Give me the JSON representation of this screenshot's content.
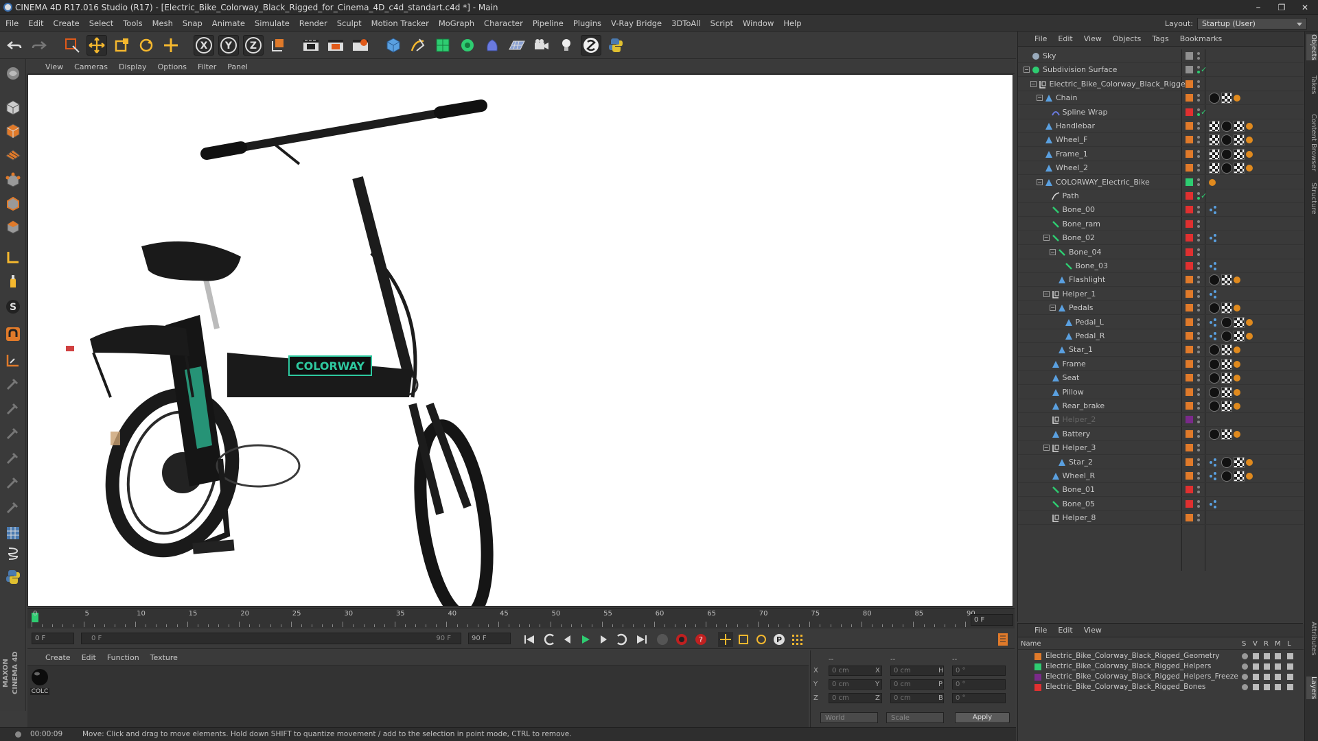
{
  "window": {
    "title": "CINEMA 4D R17.016 Studio (R17) - [Electric_Bike_Colorway_Black_Rigged_for_Cinema_4D_c4d_standart.c4d *] - Main",
    "minimize": "–",
    "maximize": "❐",
    "close": "✕"
  },
  "menubar": {
    "items": [
      "File",
      "Edit",
      "Create",
      "Select",
      "Tools",
      "Mesh",
      "Snap",
      "Animate",
      "Simulate",
      "Render",
      "Sculpt",
      "Motion Tracker",
      "MoGraph",
      "Character",
      "Pipeline",
      "Plugins",
      "V-Ray Bridge",
      "3DToAll",
      "Script",
      "Window",
      "Help"
    ],
    "layout_label": "Layout:",
    "layout_value": "Startup (User)"
  },
  "viewport": {
    "menu": [
      "View",
      "Cameras",
      "Display",
      "Options",
      "Filter",
      "Panel"
    ],
    "logo_text": "COLORWAY"
  },
  "timeline": {
    "labels": [
      "0",
      "5",
      "10",
      "15",
      "20",
      "25",
      "30",
      "35",
      "40",
      "45",
      "50",
      "55",
      "60",
      "65",
      "70",
      "75",
      "80",
      "85",
      "90"
    ],
    "frame_end_field": "0 F",
    "start_field": "0 F",
    "range_left": "0 F",
    "range_right": "90 F",
    "end_field": "90 F"
  },
  "materials": {
    "menu": [
      "Create",
      "Edit",
      "Function",
      "Texture"
    ],
    "items": [
      {
        "label": "COLC"
      }
    ]
  },
  "coords": {
    "col1_header": "--",
    "col2_header": "--",
    "col3_header": "--",
    "rows": [
      {
        "axis": "X",
        "pos": "0 cm",
        "axis2": "X",
        "size": "0 cm",
        "axis3": "H",
        "rot": "0 °"
      },
      {
        "axis": "Y",
        "pos": "0 cm",
        "axis2": "Y",
        "size": "0 cm",
        "axis3": "P",
        "rot": "0 °"
      },
      {
        "axis": "Z",
        "pos": "0 cm",
        "axis2": "Z",
        "size": "0 cm",
        "axis3": "B",
        "rot": "0 °"
      }
    ],
    "mode": "World",
    "size_mode": "Scale",
    "apply": "Apply"
  },
  "status": {
    "time": "00:00:09",
    "message": "Move: Click and drag to move elements. Hold down SHIFT to quantize movement / add to the selection in point mode, CTRL to remove."
  },
  "objects": {
    "menu": [
      "File",
      "Edit",
      "View",
      "Objects",
      "Tags",
      "Bookmarks"
    ],
    "items": [
      {
        "name": "Sky",
        "indent": 0,
        "color": "#909090",
        "icon": "sky",
        "tags": []
      },
      {
        "name": "Subdivision Surface",
        "indent": 0,
        "color": "#909090",
        "icon": "subd",
        "tags": [],
        "check": true
      },
      {
        "name": "Electric_Bike_Colorway_Black_Rigged",
        "indent": 1,
        "color": "#e07a2a",
        "icon": "null",
        "tags": []
      },
      {
        "name": "Chain",
        "indent": 2,
        "color": "#e07a2a",
        "icon": "poly",
        "tags": [
          "b",
          "c",
          "o"
        ]
      },
      {
        "name": "Spline Wrap",
        "indent": 3,
        "color": "#e03030",
        "icon": "deform",
        "tags": [],
        "check": true
      },
      {
        "name": "Handlebar",
        "indent": 2,
        "color": "#e07a2a",
        "icon": "poly",
        "tags": [
          "p",
          "b",
          "c",
          "o"
        ]
      },
      {
        "name": "Wheel_F",
        "indent": 2,
        "color": "#e07a2a",
        "icon": "poly",
        "tags": [
          "p",
          "b",
          "c",
          "o"
        ]
      },
      {
        "name": "Frame_1",
        "indent": 2,
        "color": "#e07a2a",
        "icon": "poly",
        "tags": [
          "p",
          "b",
          "c",
          "o"
        ]
      },
      {
        "name": "Wheel_2",
        "indent": 2,
        "color": "#e07a2a",
        "icon": "poly",
        "tags": [
          "p",
          "b",
          "c",
          "o"
        ]
      },
      {
        "name": "COLORWAY_Electric_Bike",
        "indent": 2,
        "color": "#2ecc71",
        "icon": "poly",
        "tags": [
          "o"
        ]
      },
      {
        "name": "Path",
        "indent": 3,
        "color": "#e03030",
        "icon": "spline",
        "tags": [],
        "check": true
      },
      {
        "name": "Bone_00",
        "indent": 3,
        "color": "#e03030",
        "icon": "bone",
        "tags": [
          "ik"
        ]
      },
      {
        "name": "Bone_ram",
        "indent": 3,
        "color": "#e03030",
        "icon": "bone",
        "tags": []
      },
      {
        "name": "Bone_02",
        "indent": 3,
        "color": "#e03030",
        "icon": "bone",
        "tags": [
          "ik"
        ]
      },
      {
        "name": "Bone_04",
        "indent": 4,
        "color": "#e03030",
        "icon": "bone",
        "tags": []
      },
      {
        "name": "Bone_03",
        "indent": 5,
        "color": "#e03030",
        "icon": "bone",
        "tags": [
          "ik"
        ]
      },
      {
        "name": "Flashlight",
        "indent": 4,
        "color": "#e07a2a",
        "icon": "poly",
        "tags": [
          "b",
          "c",
          "o"
        ]
      },
      {
        "name": "Helper_1",
        "indent": 3,
        "color": "#e07a2a",
        "icon": "null",
        "tags": [
          "ik"
        ]
      },
      {
        "name": "Pedals",
        "indent": 4,
        "color": "#e07a2a",
        "icon": "poly",
        "tags": [
          "b",
          "c",
          "o"
        ]
      },
      {
        "name": "Pedal_L",
        "indent": 5,
        "color": "#e07a2a",
        "icon": "poly",
        "tags": [
          "ik",
          "b",
          "c",
          "o"
        ]
      },
      {
        "name": "Pedal_R",
        "indent": 5,
        "color": "#e07a2a",
        "icon": "poly",
        "tags": [
          "ik",
          "b",
          "c",
          "o"
        ]
      },
      {
        "name": "Star_1",
        "indent": 4,
        "color": "#e07a2a",
        "icon": "poly",
        "tags": [
          "b",
          "c",
          "o"
        ]
      },
      {
        "name": "Frame",
        "indent": 3,
        "color": "#e07a2a",
        "icon": "poly",
        "tags": [
          "b",
          "c",
          "o"
        ]
      },
      {
        "name": "Seat",
        "indent": 3,
        "color": "#e07a2a",
        "icon": "poly",
        "tags": [
          "b",
          "c",
          "o"
        ]
      },
      {
        "name": "Pillow",
        "indent": 3,
        "color": "#e07a2a",
        "icon": "poly",
        "tags": [
          "b",
          "c",
          "o"
        ]
      },
      {
        "name": "Rear_brake",
        "indent": 3,
        "color": "#e07a2a",
        "icon": "poly",
        "tags": [
          "b",
          "c",
          "o"
        ]
      },
      {
        "name": "Helper_2",
        "indent": 3,
        "color": "#7a2a8a",
        "icon": "null",
        "tags": [],
        "dim": true
      },
      {
        "name": "Battery",
        "indent": 3,
        "color": "#e07a2a",
        "icon": "poly",
        "tags": [
          "b",
          "c",
          "o"
        ]
      },
      {
        "name": "Helper_3",
        "indent": 3,
        "color": "#e07a2a",
        "icon": "null",
        "tags": []
      },
      {
        "name": "Star_2",
        "indent": 4,
        "color": "#e07a2a",
        "icon": "poly",
        "tags": [
          "ik",
          "b",
          "c",
          "o"
        ]
      },
      {
        "name": "Wheel_R",
        "indent": 3,
        "color": "#e07a2a",
        "icon": "poly",
        "tags": [
          "ik",
          "b",
          "c",
          "o"
        ]
      },
      {
        "name": "Bone_01",
        "indent": 3,
        "color": "#e03030",
        "icon": "bone",
        "tags": []
      },
      {
        "name": "Bone_05",
        "indent": 3,
        "color": "#e03030",
        "icon": "bone",
        "tags": [
          "ik"
        ]
      },
      {
        "name": "Helper_8",
        "indent": 3,
        "color": "#e07a2a",
        "icon": "null",
        "tags": []
      }
    ]
  },
  "layers": {
    "menu": [
      "File",
      "Edit",
      "View"
    ],
    "headers": {
      "name": "Name",
      "s": "S",
      "v": "V",
      "r": "R",
      "m": "M",
      "l": "L"
    },
    "items": [
      {
        "name": "Electric_Bike_Colorway_Black_Rigged_Geometry",
        "color": "#e07a2a"
      },
      {
        "name": "Electric_Bike_Colorway_Black_Rigged_Helpers",
        "color": "#2ecc71"
      },
      {
        "name": "Electric_Bike_Colorway_Black_Rigged_Helpers_Freeze",
        "color": "#7a2a8a"
      },
      {
        "name": "Electric_Bike_Colorway_Black_Rigged_Bones",
        "color": "#e03030"
      }
    ]
  },
  "sidetabs": [
    "Objects",
    "Takes",
    "Content Browser",
    "Structure",
    "Attributes",
    "Layers"
  ]
}
